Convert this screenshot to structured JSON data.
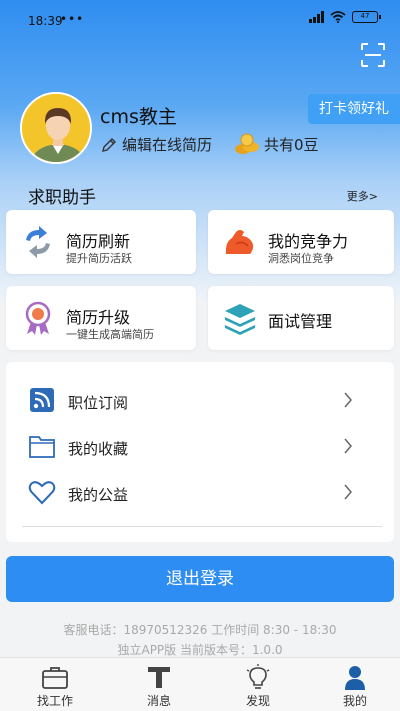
{
  "status_bar": {
    "time": "18:39",
    "dots": "•••",
    "battery": "47"
  },
  "profile": {
    "username": "cms教主",
    "edit_resume_label": "编辑在线简历",
    "beans_label": "共有0豆",
    "checkin_label": "打卡领好礼"
  },
  "job_assistant": {
    "title": "求职助手",
    "more_label": "更多>",
    "cards": [
      {
        "title": "简历刷新",
        "subtitle": "提升简历活跃",
        "icon": "refresh-icon"
      },
      {
        "title": "我的竞争力",
        "subtitle": "洞悉岗位竞争",
        "icon": "muscle-arm-icon"
      },
      {
        "title": "简历升级",
        "subtitle": "一键生成高端简历",
        "icon": "award-ribbon-icon"
      },
      {
        "title": "面试管理",
        "subtitle": "",
        "icon": "layers-icon"
      }
    ]
  },
  "menu": {
    "items": [
      {
        "label": "职位订阅",
        "icon": "rss-icon"
      },
      {
        "label": "我的收藏",
        "icon": "folder-icon"
      },
      {
        "label": "我的公益",
        "icon": "heart-icon"
      }
    ]
  },
  "logout_label": "退出登录",
  "footer": {
    "contact_line": "客服电话：18970512326 工作时间 8:30 - 18:30",
    "version_line": "独立APP版 当前版本号：1.0.0"
  },
  "tabbar": {
    "tabs": [
      {
        "label": "找工作",
        "icon": "briefcase-icon",
        "active": false
      },
      {
        "label": "消息",
        "icon": "message-icon",
        "active": false
      },
      {
        "label": "发现",
        "icon": "lightbulb-icon",
        "active": false
      },
      {
        "label": "我的",
        "icon": "person-icon",
        "active": true
      }
    ]
  },
  "colors": {
    "primary": "#2d8df3",
    "checkin_bg": "#3fa0f6",
    "header_top": "#2f8df0"
  }
}
